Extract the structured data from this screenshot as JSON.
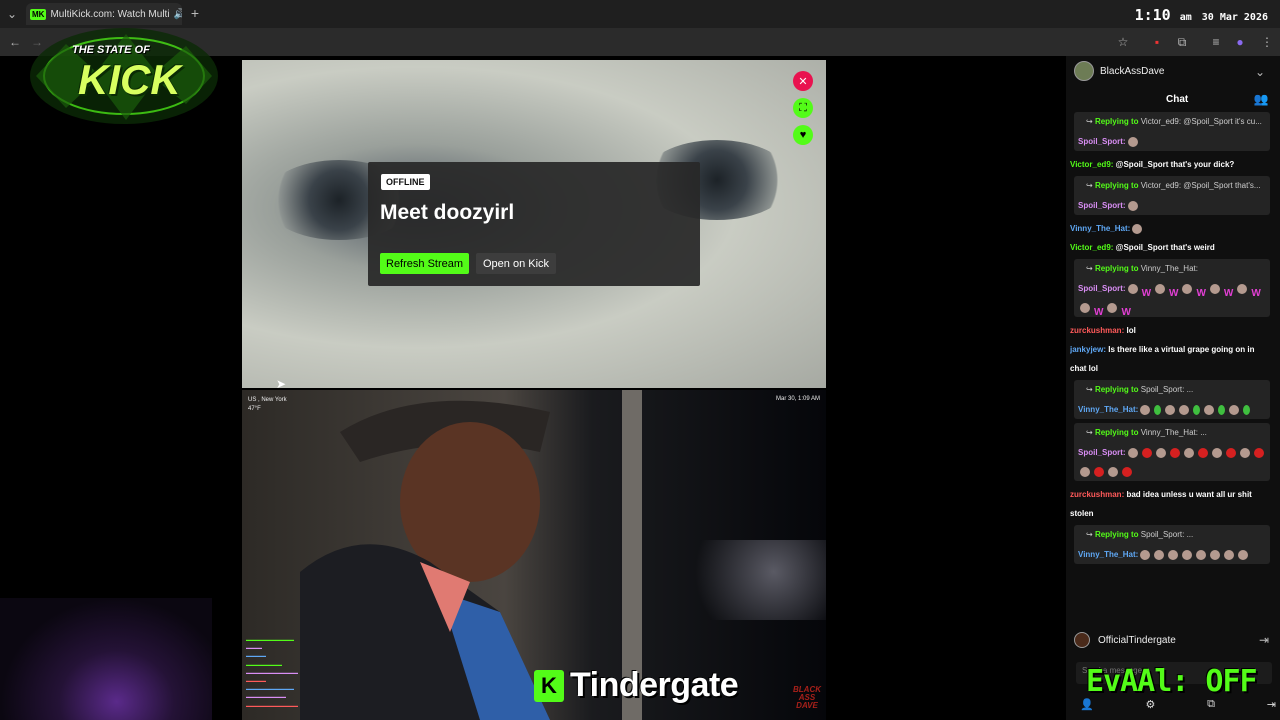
{
  "browser": {
    "tab_title": "MultiKick.com: Watch Multi",
    "favicon_text": "MK"
  },
  "clock": {
    "time": "1:10",
    "ampm": "am",
    "date": "30 Mar 2026"
  },
  "overlay": {
    "logo_lines": [
      "THE STATE OF",
      "KICK"
    ]
  },
  "player_top": {
    "offline_badge": "OFFLINE",
    "title": "Meet doozyirl",
    "refresh_label": "Refresh Stream",
    "open_label": "Open on Kick"
  },
  "player_bottom": {
    "location": "US , New York",
    "temp": "47°F",
    "timestamp": "Mar 30, 1:09 AM",
    "caption": "Tindergate",
    "caption_logo": "K",
    "watermark": [
      "BLACK",
      "ASS",
      "DAVE"
    ]
  },
  "chat": {
    "channel_user": "BlackAssDave",
    "title": "Chat",
    "replying_to": "Replying to",
    "messages": [
      {
        "type": "reply",
        "to": "Victor_ed9:",
        "snippet": "@Spoil_Sport it's cu...",
        "user": "Spoil_Sport:",
        "user_color": "#d98ef4",
        "text": "",
        "emotes": "p"
      },
      {
        "type": "msg",
        "user": "Victor_ed9:",
        "user_color": "#53fc18",
        "text": "@Spoil_Sport that's your dick?"
      },
      {
        "type": "reply",
        "to": "Victor_ed9:",
        "snippet": "@Spoil_Sport that's...",
        "user": "Spoil_Sport:",
        "user_color": "#d98ef4",
        "text": "",
        "emotes": "p"
      },
      {
        "type": "msg",
        "user": "Vinny_The_Hat:",
        "user_color": "#5fa8f5",
        "text": "",
        "emotes": "p"
      },
      {
        "type": "msg",
        "user": "Victor_ed9:",
        "user_color": "#53fc18",
        "text": "@Spoil_Sport that's weird"
      },
      {
        "type": "reply",
        "to": "Vinny_The_Hat:",
        "snippet": "",
        "user": "Spoil_Sport:",
        "user_color": "#d98ef4",
        "text": "",
        "emotes": "pwpwpwpwpwpwpw"
      },
      {
        "type": "msg",
        "user": "zurckushman:",
        "user_color": "#ff5a5a",
        "text": "lol"
      },
      {
        "type": "msg",
        "user": "jankyjew:",
        "user_color": "#5fa8f5",
        "text": "Is there like a virtual grape going on in chat lol"
      },
      {
        "type": "reply",
        "to": "Spoil_Sport:",
        "snippet": "...",
        "user": "Vinny_The_Hat:",
        "user_color": "#5fa8f5",
        "text": "",
        "emotes": "pgppgpgpg"
      },
      {
        "type": "reply",
        "to": "Vinny_The_Hat:",
        "snippet": "...",
        "user": "Spoil_Sport:",
        "user_color": "#d98ef4",
        "text": "",
        "emotes": "prprprprprprpr"
      },
      {
        "type": "msg",
        "user": "zurckushman:",
        "user_color": "#ff5a5a",
        "text": "bad idea unless u want all ur shit stolen"
      },
      {
        "type": "reply",
        "to": "Spoil_Sport:",
        "snippet": "...",
        "user": "Vinny_The_Hat:",
        "user_color": "#5fa8f5",
        "text": "",
        "emotes": "pppppppp"
      }
    ],
    "pinned_user": "OfficialTindergate",
    "input_placeholder": "Send a message",
    "evaal_overlay": "EvAAl: OFF"
  },
  "colors": {
    "kick_green": "#53fc18",
    "offline_red": "#e9124f"
  }
}
